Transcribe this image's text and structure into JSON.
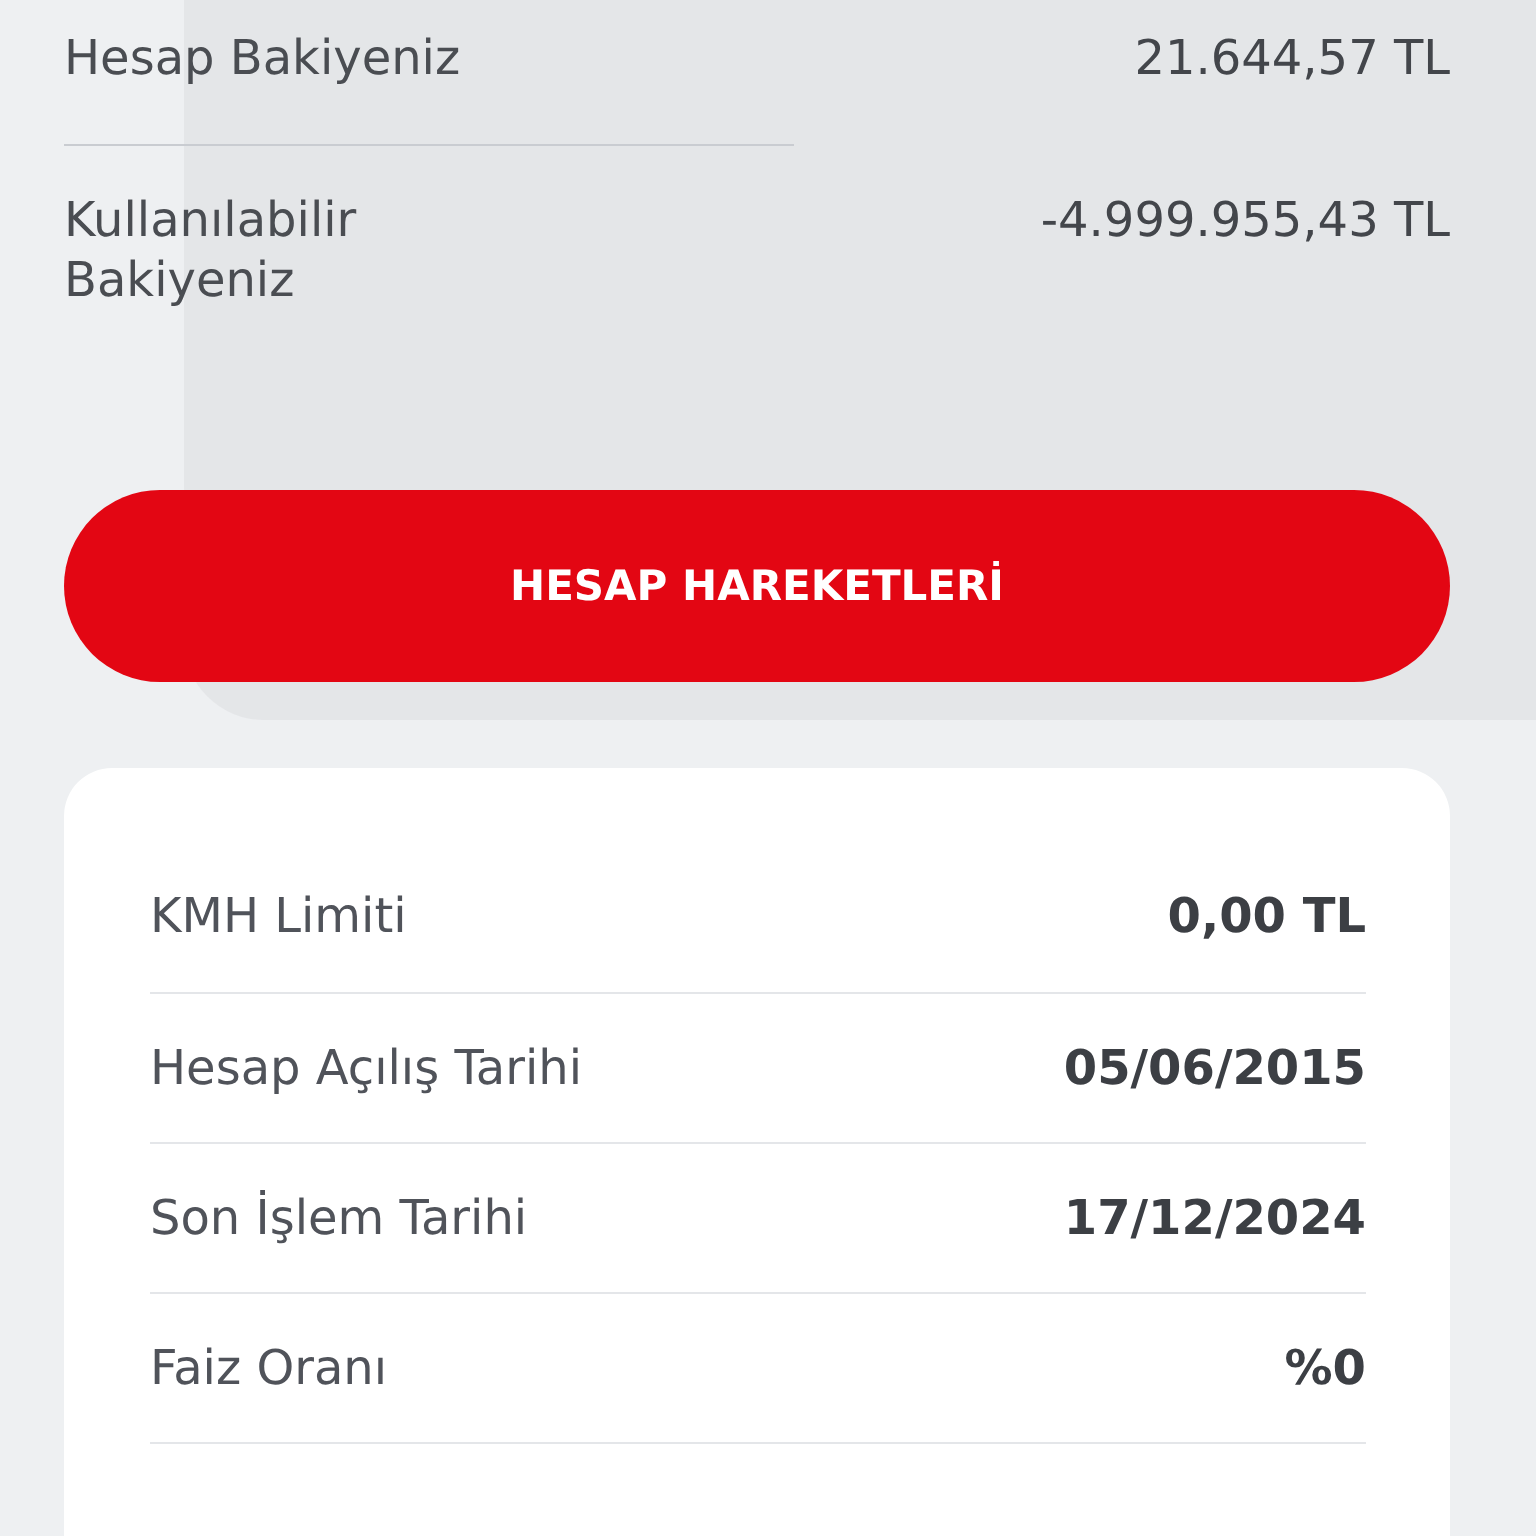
{
  "balances": [
    {
      "label": "Hesap Bakiyeniz",
      "value": "21.644,57 TL"
    },
    {
      "label": "Kullanılabilir Bakiyeniz",
      "value": "-4.999.955,43 TL"
    }
  ],
  "action_button": {
    "label": "HESAP HAREKETLERİ"
  },
  "details": [
    {
      "label": "KMH Limiti",
      "value": "0,00 TL"
    },
    {
      "label": "Hesap Açılış Tarihi",
      "value": "05/06/2015"
    },
    {
      "label": "Son İşlem Tarihi",
      "value": "17/12/2024"
    },
    {
      "label": "Faiz Oranı",
      "value": "%0"
    }
  ]
}
